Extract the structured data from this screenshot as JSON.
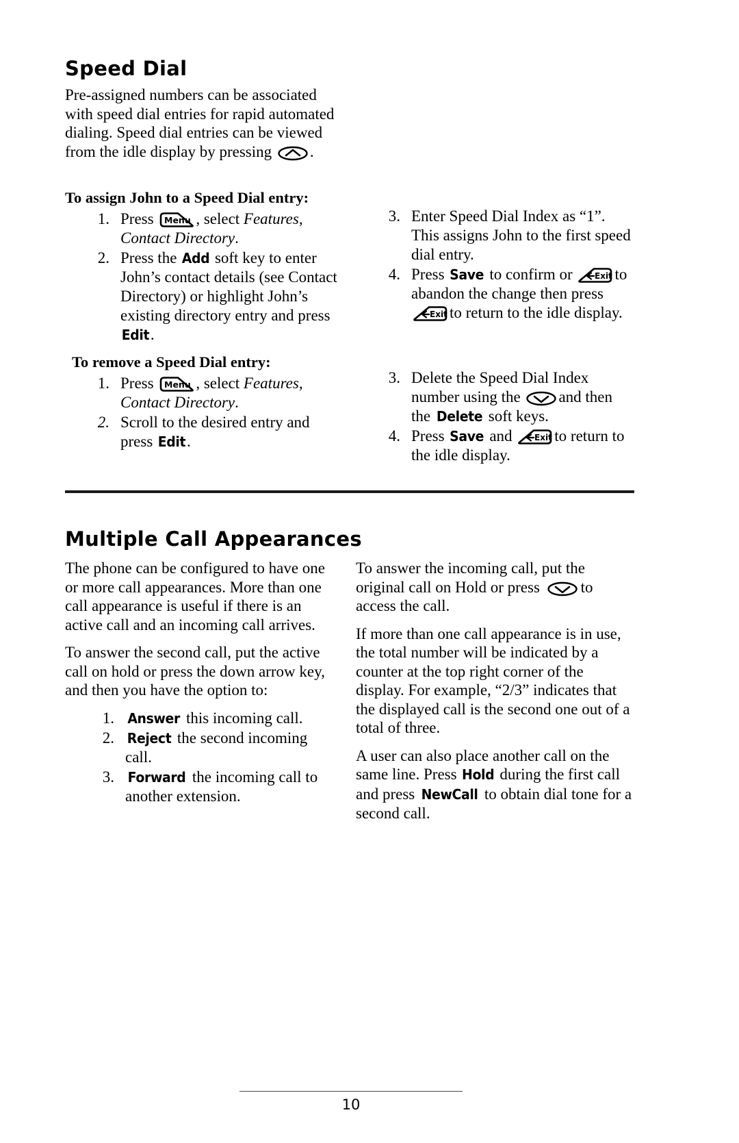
{
  "page": {
    "number": "10"
  },
  "sections": [
    {
      "heading": "Speed Dial",
      "intro": {
        "part1": "Pre-assigned numbers can be associated with speed dial entries for rapid automated dialing.  Speed dial entries can be viewed from the idle display by pressing",
        "icon": "up-arrow-key-icon",
        "part2": "."
      },
      "procedures": [
        {
          "title": "To assign John to a Speed Dial entry:",
          "left_steps": [
            {
              "num": "1.",
              "pre": "Press",
              "icon": "menu-key-icon",
              "mid": ", select",
              "italic": "Features, Contact Directory",
              "post": "."
            },
            {
              "num": "2.",
              "pre": "Press the",
              "softkey1": "Add",
              "mid": "soft key to enter John’s contact details (see Contact Directory) or highlight John’s existing directory entry and press",
              "softkey2": "Edit",
              "post": "."
            }
          ],
          "right_steps": [
            {
              "num": "3.",
              "text": "Enter Speed Dial Index as “1”. This assigns John to the first speed dial entry."
            },
            {
              "num": "4.",
              "pre": "Press",
              "softkey1": "Save",
              "mid": "to confirm or",
              "icon1": "exit-key-icon",
              "mid2": "to abandon the change then press",
              "icon2": "exit-key-icon",
              "post": "to return to the idle display."
            }
          ]
        },
        {
          "title": "To remove a Speed Dial entry:",
          "left_steps": [
            {
              "num": "1.",
              "pre": "Press",
              "icon": "menu-key-icon",
              "mid": ", select",
              "italic": "Features, Contact Directory",
              "post": "."
            },
            {
              "num": "2.",
              "pre": "Scroll to the desired entry and press",
              "softkey1": "Edit",
              "post": "."
            }
          ],
          "right_steps": [
            {
              "num": "3.",
              "pre": "Delete the Speed Dial Index number using the",
              "icon1": "down-arrow-key-icon",
              "mid": "and then the",
              "softkey1": "Delete",
              "post": "soft keys."
            },
            {
              "num": "4.",
              "pre": "Press",
              "softkey1": "Save",
              "mid": "and",
              "icon1": "exit-key-icon",
              "post": "to return to the idle display."
            }
          ]
        }
      ]
    },
    {
      "heading": "Multiple Call Appearances",
      "left_paragraphs": [
        "The phone can be configured to have one or more call appearances.  More than one call appearance is useful if there is an active call and an incoming call arrives.",
        "To answer the second call, put the active call on hold or press the down arrow key, and then you have the option to:"
      ],
      "left_steps": [
        {
          "num": "1.",
          "softkey": "Answer",
          "text": "this incoming call."
        },
        {
          "num": "2.",
          "softkey": "Reject",
          "text": "the second incoming call."
        },
        {
          "num": "3.",
          "softkey": "Forward",
          "text": "the incoming call to another extension."
        }
      ],
      "right_paragraphs": [
        {
          "pre": "To answer the incoming call, put the original call on Hold or press",
          "icon": "down-arrow-key-icon",
          "post": "to access the call."
        },
        {
          "text": "If more than one call appearance is in use, the total number will be indicated by a counter at the top right corner of the display.  For example, “2/3” indicates that the displayed call is the second one out of a total of three."
        },
        {
          "pre": "A user can also place another call on the same line.  Press",
          "softkey1": "Hold",
          "mid": "during the first call and press",
          "softkey2": "NewCall",
          "post": "to obtain dial tone for a second call."
        }
      ]
    }
  ],
  "icons": {
    "menu_label": "Menu",
    "exit_label": "Exit"
  },
  "colors": {
    "text": "#000000",
    "rule": "#1a1a1a",
    "footer_rule": "#4a4a4a"
  }
}
